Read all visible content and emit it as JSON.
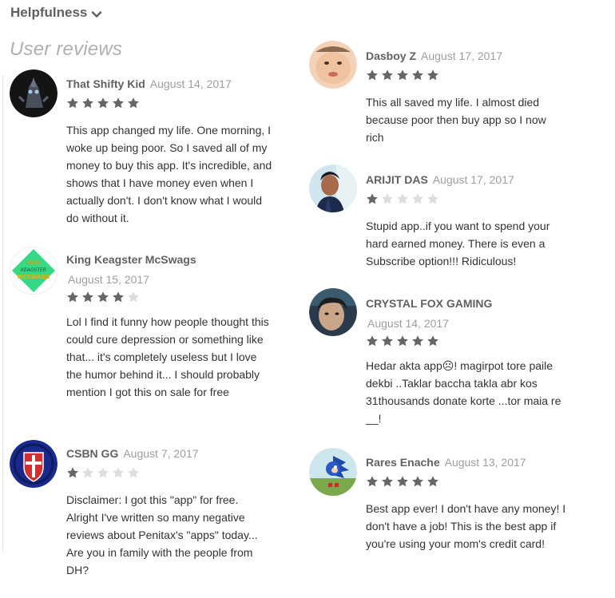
{
  "sort": {
    "label": "Helpfulness"
  },
  "section": {
    "title": "User reviews"
  },
  "colors": {
    "star_filled": "#666666",
    "star_empty": "#dddddd"
  },
  "reviews": [
    {
      "author": "That Shifty Kid",
      "date": "August 14, 2017",
      "rating": 5,
      "avatar": "dark-creature-avatar",
      "text": "This app changed my life. One morning, I woke up being poor. So I saved all of my money to buy this app. It's incredible, and shows that I have money even when I actually don't. I don't know what I would do without it."
    },
    {
      "author": "King Keagster McSwags",
      "date": "August 15, 2017",
      "rating": 4,
      "avatar": "green-logo-avatar",
      "avatar_text": [
        "KING",
        "KEAGSTER",
        "MCSWAGS"
      ],
      "text": "Lol I find it funny how people thought this could cure depression or something like that... it's completely useless but I love the humor behind it... I should probably mention I got this on sale for free"
    },
    {
      "author": "CSBN GG",
      "date": "August 7, 2017",
      "rating": 1,
      "avatar": "shield-cross-avatar",
      "text": "Disclaimer: I got this \"app\" for free. Alright I've written so many negative reviews about Penitax's \"apps\" today... Are you in family with the people from DH?"
    },
    {
      "author": "Dasboy Z",
      "date": "August 17, 2017",
      "rating": 5,
      "avatar": "baby-face-avatar",
      "text": "This all saved my life. I almost died because poor then buy app so I now rich"
    },
    {
      "author": "ARIJIT DAS",
      "date": "August 17, 2017",
      "rating": 1,
      "avatar": "person-photo-avatar",
      "text": "Stupid app..if you want to spend your hard earned money. There is even a Subscribe option!!! Ridiculous!"
    },
    {
      "author": "CRYSTAL FOX GAMING",
      "date": "August 14, 2017",
      "rating": 5,
      "avatar": "face-photo-avatar",
      "text": "Hedar akta app☹! magirpot tore paile dekbi ..Taklar baccha takla abr kos 31thousands donate korte ...tor maia re __!"
    },
    {
      "author": "Rares Enache",
      "date": "August 13, 2017",
      "rating": 5,
      "avatar": "blue-hedgehog-avatar",
      "text": "Best app ever! I don't have any money! I don't have a job! This is the best app if you're using your mom's credit card!"
    }
  ]
}
